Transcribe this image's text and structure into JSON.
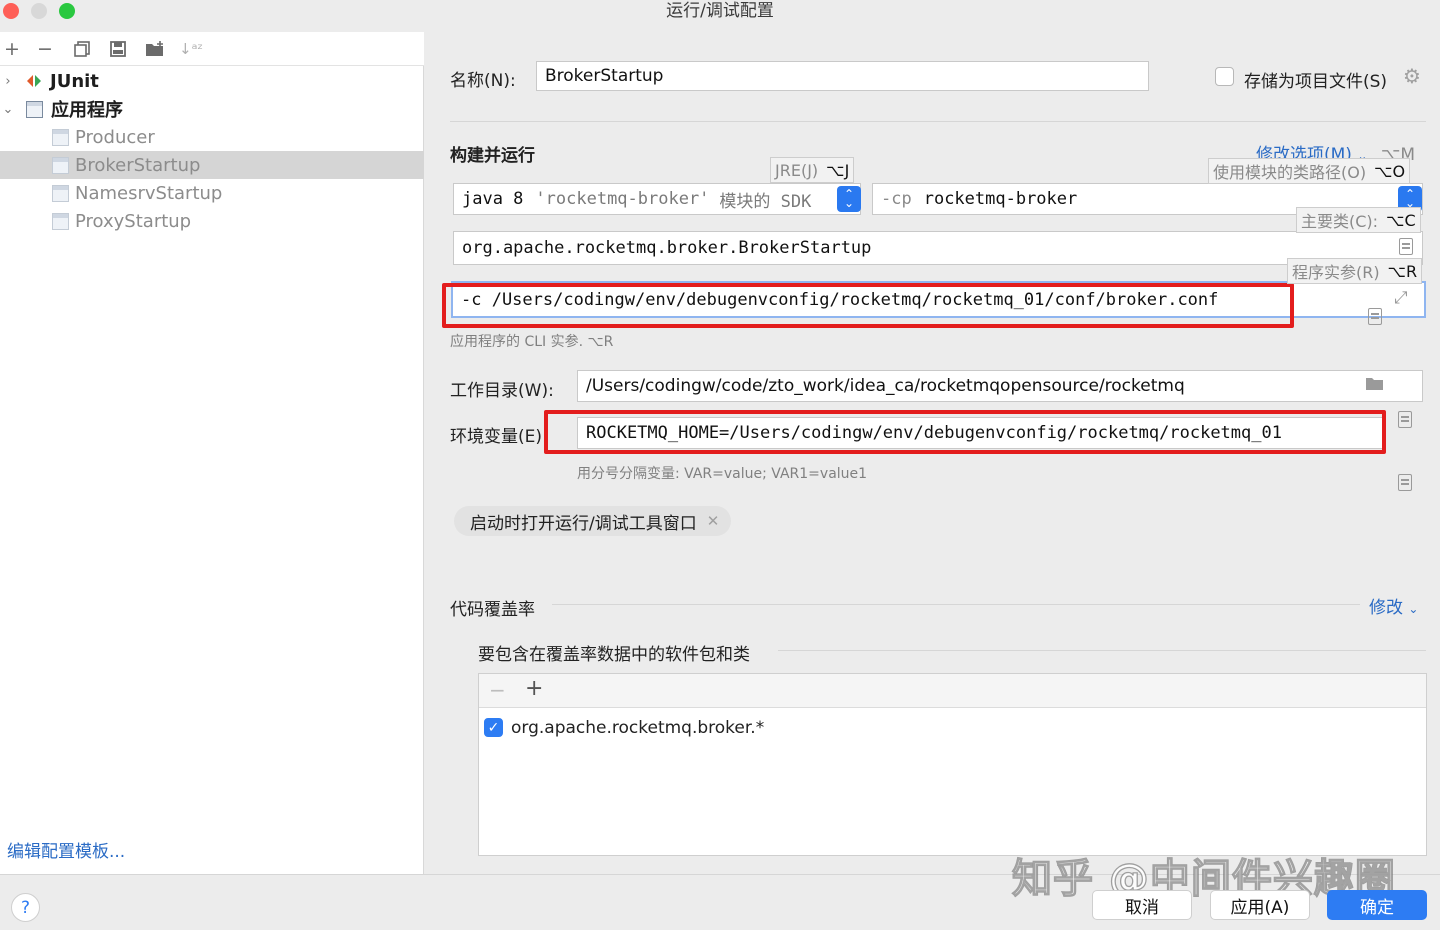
{
  "window": {
    "title": "运行/调试配置"
  },
  "left": {
    "tree": [
      {
        "label": "JUnit",
        "expanded": false
      },
      {
        "label": "应用程序",
        "expanded": true,
        "children": [
          "Producer",
          "BrokerStartup",
          "NamesrvStartup",
          "ProxyStartup"
        ],
        "selected": "BrokerStartup"
      }
    ],
    "edit_templates": "编辑配置模板..."
  },
  "form": {
    "name_label": "名称(N):",
    "name_value": "BrokerStartup",
    "store_label": "存储为项目文件(S)",
    "build_run": "构建并运行",
    "modify_options": "修改选项(M)",
    "modify_shortcut": "⌥M",
    "jre_tip": "JRE(J)",
    "jre_key": "⌥J",
    "classpath_tip": "使用模块的类路径(O)",
    "classpath_key": "⌥O",
    "mainclass_tip": "主要类(C):",
    "mainclass_key": "⌥C",
    "args_tip": "程序实参(R)",
    "args_key": "⌥R",
    "sdk_java": "java 8",
    "sdk_module": "'rocketmq-broker'",
    "sdk_suffix": "模块的 SDK",
    "cp_flag": "-cp",
    "cp_value": "rocketmq-broker",
    "main_class": "org.apache.rocketmq.broker.BrokerStartup",
    "program_args": "-c /Users/codingw/env/debugenvconfig/rocketmq/rocketmq_01/conf/broker.conf",
    "program_args_hint": "应用程序的 CLI 实参. ⌥R",
    "workdir_label": "工作目录(W):",
    "workdir_value": "/Users/codingw/code/zto_work/idea_ca/rocketmqopensource/rocketmq",
    "env_label": "环境变量(E):",
    "env_value": "ROCKETMQ_HOME=/Users/codingw/env/debugenvconfig/rocketmq/rocketmq_01",
    "env_hint": "用分号分隔变量: VAR=value; VAR1=value1",
    "chip_label": "启动时打开运行/调试工具窗口",
    "coverage_label": "代码覆盖率",
    "coverage_modify": "修改",
    "coverage_include_label": "要包含在覆盖率数据中的软件包和类",
    "coverage_items": [
      {
        "label": "org.apache.rocketmq.broker.*",
        "checked": true
      }
    ]
  },
  "footer": {
    "help": "?",
    "cancel": "取消",
    "apply": "应用(A)",
    "ok": "确定"
  },
  "watermark": "知乎 @中间件兴趣圈",
  "colors": {
    "accent": "#2d7cf3",
    "highlight_box": "#e31d1d",
    "selection": "#d5d5d5"
  }
}
